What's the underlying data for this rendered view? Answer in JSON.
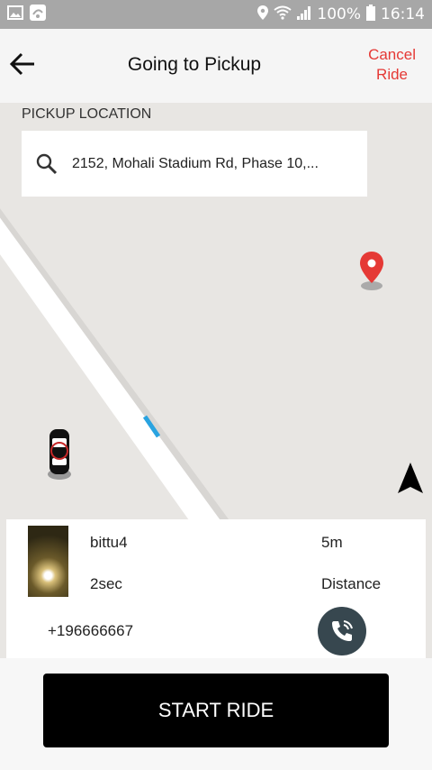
{
  "status_bar": {
    "battery": "100%",
    "time": "16:14",
    "icons": [
      "gallery-icon",
      "app-icon",
      "location-icon",
      "wifi-icon",
      "signal-icon",
      "battery-icon"
    ]
  },
  "header": {
    "title": "Going to Pickup",
    "cancel_line1": "Cancel",
    "cancel_line2": "Ride"
  },
  "pickup": {
    "label": "PICKUP LOCATION",
    "address": "2152, Mohali Stadium Rd, Phase 10,..."
  },
  "driver": {
    "name": "bittu4",
    "eta": "2sec",
    "phone": "+196666667",
    "distance_value": "5m",
    "distance_label": "Distance"
  },
  "actions": {
    "start_ride": "START RIDE"
  },
  "colors": {
    "accent_red": "#e53935",
    "call_button": "#37474f",
    "map_bg": "#e8e6e3"
  }
}
